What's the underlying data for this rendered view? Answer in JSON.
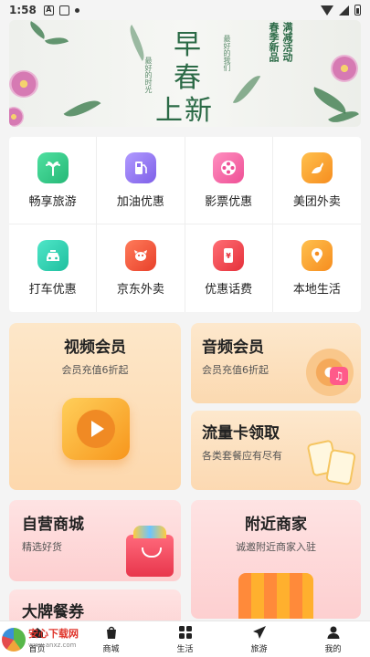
{
  "status_bar": {
    "time": "1:58",
    "icons": [
      "notification-a-icon",
      "notification-square-icon",
      "dot-icon",
      "wifi-icon",
      "cellular-icon",
      "battery-icon"
    ]
  },
  "banner": {
    "title_line1": "早春",
    "title_line2": "上新",
    "small_left": "最好的时光",
    "small_right": "最好的我们",
    "side_lines": [
      "春季新品",
      "满减活动"
    ]
  },
  "services": [
    {
      "label": "畅享旅游",
      "icon": "palm-tree-icon",
      "color": "#35c98a"
    },
    {
      "label": "加油优惠",
      "icon": "fuel-pump-icon",
      "color": "#9b7cf3"
    },
    {
      "label": "影票优惠",
      "icon": "film-reel-icon",
      "color": "#f56aa8"
    },
    {
      "label": "美团外卖",
      "icon": "kangaroo-icon",
      "color": "#f9a33a"
    },
    {
      "label": "打车优惠",
      "icon": "taxi-icon",
      "color": "#2ecdb0"
    },
    {
      "label": "京东外卖",
      "icon": "dog-icon",
      "color": "#f25a3c"
    },
    {
      "label": "优惠话费",
      "icon": "phone-bill-icon",
      "color": "#f2474f"
    },
    {
      "label": "本地生活",
      "icon": "location-pin-icon",
      "color": "#f9a33a"
    }
  ],
  "cards": {
    "video": {
      "title": "视频会员",
      "subtitle": "会员充值6折起"
    },
    "audio": {
      "title": "音频会员",
      "subtitle": "会员充值6折起"
    },
    "flow": {
      "title": "流量卡领取",
      "subtitle": "各类套餐应有尽有"
    },
    "mall": {
      "title": "自营商城",
      "subtitle": "精选好货"
    },
    "nearby": {
      "title": "附近商家",
      "subtitle": "诚邀附近商家入驻"
    },
    "food": {
      "title": "大牌餐券"
    }
  },
  "bottom_nav": [
    {
      "label": "首页",
      "icon": "home-icon"
    },
    {
      "label": "商城",
      "icon": "shopping-bag-icon"
    },
    {
      "label": "生活",
      "icon": "grid-icon"
    },
    {
      "label": "旅游",
      "icon": "paper-plane-icon"
    },
    {
      "label": "我的",
      "icon": "person-icon"
    }
  ],
  "watermark": {
    "name": "安心下载网",
    "url": "www.anxz.com"
  }
}
